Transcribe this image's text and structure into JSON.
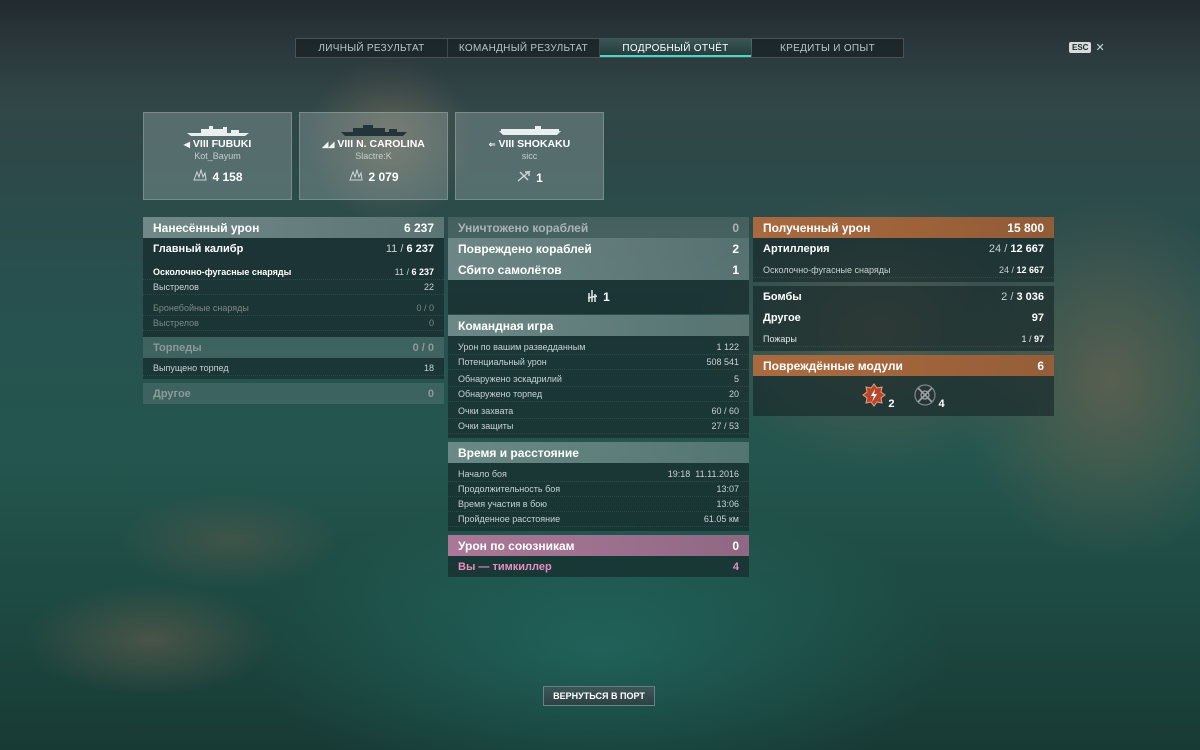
{
  "tabs": [
    {
      "label": "ЛИЧНЫЙ РЕЗУЛЬТАТ"
    },
    {
      "label": "КОМАНДНЫЙ РЕЗУЛЬТАТ"
    },
    {
      "label": "ПОДРОБНЫЙ ОТЧЁТ",
      "active": true
    },
    {
      "label": "КРЕДИТЫ И ОПЫТ"
    }
  ],
  "esc": {
    "key": "ESC",
    "close": "✕"
  },
  "ships": [
    {
      "tier_name": "VIII FUBUKI",
      "class_icon": "destroyer-icon",
      "player": "Kot_Bayum",
      "stat_icon": "damage-icon",
      "stat": "4 158"
    },
    {
      "tier_name": "VIII N. CAROLINA",
      "class_icon": "battleship-icon",
      "player": "Slactre:K",
      "stat_icon": "damage-icon",
      "stat": "2 079"
    },
    {
      "tier_name": "VIII SHOKAKU",
      "class_icon": "carrier-icon",
      "player": "sicc",
      "stat_icon": "plane-kill-icon",
      "stat": "1"
    }
  ],
  "left": {
    "damage_dealt": {
      "label": "Нанесённый урон",
      "value": "6 237"
    },
    "main_battery": {
      "label": "Главный калибр",
      "hits": "11",
      "value": "6 237"
    },
    "he_shells": {
      "label": "Осколочно-фугасные снаряды",
      "hits": "11",
      "value": "6 237"
    },
    "he_shots": {
      "label": "Выстрелов",
      "value": "22"
    },
    "ap_shells": {
      "label": "Бронебойные снаряды",
      "hits": "0",
      "value": "0"
    },
    "ap_shots": {
      "label": "Выстрелов",
      "value": "0"
    },
    "torpedoes": {
      "label": "Торпеды",
      "hits": "0",
      "value": "0"
    },
    "torps_launched": {
      "label": "Выпущено торпед",
      "value": "18"
    },
    "other": {
      "label": "Другое",
      "value": "0"
    }
  },
  "center": {
    "destroyed": {
      "label": "Уничтожено кораблей",
      "value": "0"
    },
    "damaged": {
      "label": "Повреждено кораблей",
      "value": "2"
    },
    "planes": {
      "label": "Сбито самолётов",
      "value": "1"
    },
    "planes_icon_count": "1",
    "teamplay": {
      "title": "Командная игра",
      "rows": [
        {
          "label": "Урон по вашим разведданным",
          "value": "1 122"
        },
        {
          "label": "Потенциальный урон",
          "value": "508 541"
        },
        {
          "label": "Обнаружено эскадрилий",
          "value": "5"
        },
        {
          "label": "Обнаружено торпед",
          "value": "20"
        },
        {
          "label": "Очки захвата",
          "value": "60 / 60"
        },
        {
          "label": "Очки защиты",
          "value": "27 / 53"
        }
      ]
    },
    "time": {
      "title": "Время и расстояние",
      "rows": [
        {
          "label": "Начало боя",
          "value": "19:18  11.11.2016"
        },
        {
          "label": "Продолжительность боя",
          "value": "13:07"
        },
        {
          "label": "Время участия в бою",
          "value": "13:06"
        },
        {
          "label": "Пройденное расстояние",
          "value": "61.05 км"
        }
      ]
    },
    "ally_damage": {
      "label": "Урон по союзникам",
      "value": "0"
    },
    "teamkiller": {
      "label": "Вы — тимкиллер",
      "value": "4"
    }
  },
  "right": {
    "received": {
      "label": "Полученный урон",
      "value": "15 800"
    },
    "artillery": {
      "label": "Артиллерия",
      "hits": "24",
      "value": "12 667"
    },
    "he_shells": {
      "label": "Осколочно-фугасные снаряды",
      "hits": "24",
      "value": "12 667"
    },
    "bombs": {
      "label": "Бомбы",
      "hits": "2",
      "value": "3 036"
    },
    "other": {
      "label": "Другое",
      "value": "97"
    },
    "fires": {
      "label": "Пожары",
      "hits": "1",
      "value": "97"
    },
    "modules": {
      "label": "Повреждённые модули",
      "value": "6"
    },
    "module_icons": [
      {
        "icon": "engine-damage-icon",
        "count": "2"
      },
      {
        "icon": "steering-damage-icon",
        "count": "4"
      }
    ]
  },
  "port_button": "ВЕРНУТЬСЯ В ПОРТ",
  "colors": {
    "accent": "#4fd6c4",
    "received": "#be6e3c",
    "teamkill": "#e58ec2"
  }
}
